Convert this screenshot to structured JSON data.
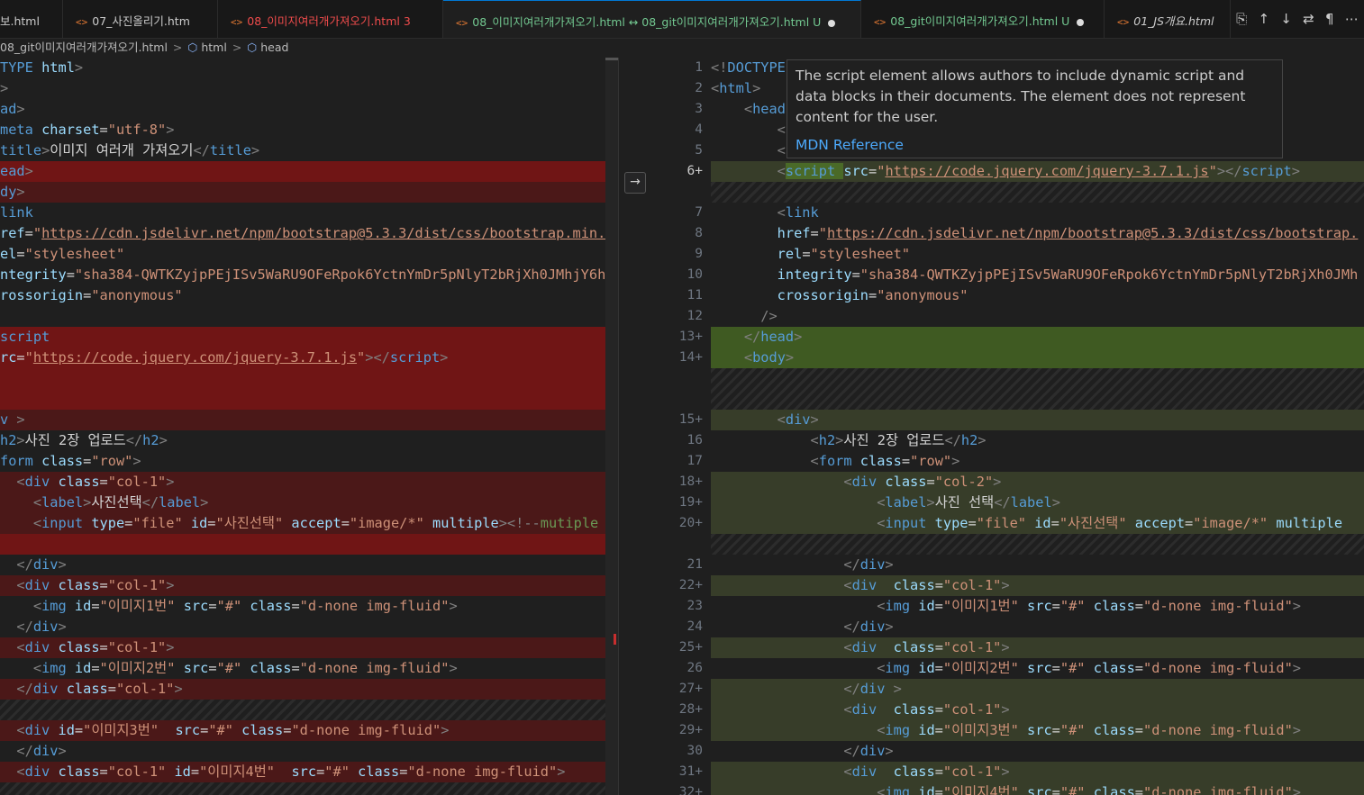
{
  "tabs": [
    {
      "label": "보.html",
      "color": "#cccccc"
    },
    {
      "label": "07_사진올리기.htm",
      "color": "#cccccc"
    },
    {
      "label": "08_이미지여러개가져오기.html 3",
      "color": "#f14c4c"
    },
    {
      "label": "08_이미지여러개가져오기.html ↔ 08_git이미지여러개가져오기.html U",
      "color": "#73c991"
    },
    {
      "label": "08_git이미지여러개가져오기.html U",
      "color": "#73c991"
    },
    {
      "label": "01_JS개요.html",
      "color": "#cccccc"
    }
  ],
  "tab_icon": "<>",
  "toolbar_icons": [
    "open-changes-icon",
    "arrow-up-icon",
    "arrow-down-icon",
    "swap-icon",
    "pilcrow-icon",
    "more-icon"
  ],
  "toolbar_glyphs": [
    "⎘",
    "↑",
    "↓",
    "⇄",
    "¶",
    "⋯"
  ],
  "breadcrumb": {
    "file": "08_git이미지여러개가져오기.html",
    "html": "html",
    "head": "head",
    "separator": ">",
    "icon": "⬡"
  },
  "tooltip": {
    "text": "The script element allows authors to include dynamic script and data blocks in their documents. The element does not represent content for the user.",
    "link": "MDN Reference"
  },
  "diff_nav_icon": "→",
  "right_line_numbers": [
    "1",
    "2",
    "3",
    "4",
    "5",
    "6+",
    "7",
    "8",
    "9",
    "10",
    "11",
    "12",
    "13+",
    "14+",
    "15+",
    "16",
    "17",
    "18+",
    "19+",
    "20+",
    "21",
    "22+",
    "23",
    "24",
    "25+",
    "26",
    "27+",
    "28+",
    "29+",
    "30",
    "31+",
    "32+"
  ]
}
